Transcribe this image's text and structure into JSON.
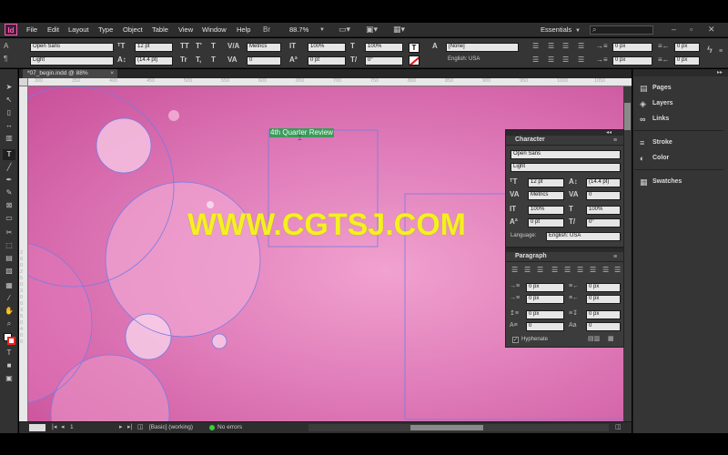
{
  "app": {
    "logo": "Id",
    "menus": [
      "File",
      "Edit",
      "Layout",
      "Type",
      "Object",
      "Table",
      "View",
      "Window",
      "Help"
    ],
    "zoom": "88.7%",
    "workspace": "Essentials",
    "search_placeholder": ""
  },
  "control": {
    "font_family": "Open Sans",
    "font_style": "Light",
    "font_size": "12 pt",
    "leading": "(14.4 pt)",
    "kerning": "Metrics",
    "tracking": "0",
    "h_scale": "100%",
    "v_scale": "100%",
    "baseline": "0 pt",
    "skew": "0°",
    "char_style": "[None]",
    "language": "English: USA",
    "indent_left": "0 px",
    "indent_right": "0 px",
    "type_glyphs": [
      "TT",
      "T'",
      "T",
      "Tr",
      "T,",
      "T"
    ]
  },
  "document": {
    "tab_title": "*07_begin.indd @ 88%",
    "text_frame_content": "4th Quarter Review",
    "watermark": "WWW.CGTSJ.COM",
    "ruler_h": [
      "300",
      "350",
      "400",
      "450",
      "500",
      "550",
      "600",
      "650",
      "700",
      "750",
      "800",
      "850",
      "900",
      "950",
      "1000",
      "1050"
    ],
    "ruler_v": [
      "2",
      "0",
      "0",
      "2",
      "5",
      "0",
      "3",
      "0",
      "0",
      "3",
      "5",
      "0",
      "4",
      "0",
      "0"
    ]
  },
  "status": {
    "page": "1",
    "style": "[Basic] (working)",
    "errors": "No errors"
  },
  "character_panel": {
    "title": "Character",
    "font_family": "Open Sans",
    "font_style": "Light",
    "size": "12 pt",
    "leading": "(14.4 pt)",
    "kerning": "Metrics",
    "tracking": "0",
    "v_scale": "100%",
    "h_scale": "100%",
    "baseline": "0 pt",
    "skew": "0°",
    "language_label": "Language:",
    "language": "English: USA"
  },
  "paragraph_panel": {
    "title": "Paragraph",
    "left_indent": "0 px",
    "right_indent": "0 px",
    "first_indent": "0 px",
    "last_indent": "0 px",
    "space_before": "0 px",
    "space_after": "0 px",
    "drop_lines": "0",
    "drop_chars": "0",
    "hyphenate_label": "Hyphenate",
    "hyphenate_checked": true
  },
  "right_panels": [
    {
      "label": "Pages",
      "icon": "pages-icon",
      "glyph": "▤"
    },
    {
      "label": "Layers",
      "icon": "layers-icon",
      "glyph": "◈"
    },
    {
      "label": "Links",
      "icon": "links-icon",
      "glyph": "∞"
    },
    {
      "label": "Stroke",
      "icon": "stroke-icon",
      "glyph": "≡"
    },
    {
      "label": "Color",
      "icon": "color-icon",
      "glyph": "◐"
    },
    {
      "label": "Swatches",
      "icon": "swatches-icon",
      "glyph": "▦"
    }
  ],
  "colors": {
    "chrome": "#323232",
    "canvas_pink": "#d766a8",
    "selection_green": "#3c9a5c",
    "frame_blue": "#7a7ae0",
    "watermark_yellow": "#f5f021"
  }
}
